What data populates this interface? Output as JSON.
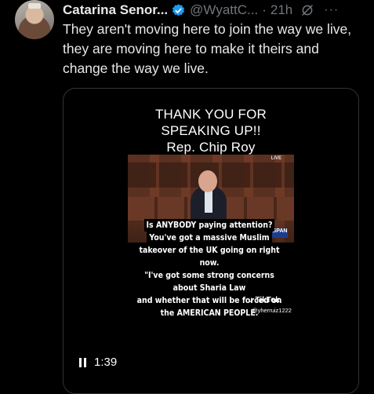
{
  "post": {
    "author_name": "Catarina Senor...",
    "handle": "@WyattC...",
    "separator": "·",
    "time": "21h",
    "more": "···",
    "text": "They aren't moving here to join the way we live, they are moving here to make it theirs and change the way we live."
  },
  "video": {
    "title_lines": [
      "THANK YOU FOR",
      "SPEAKING UP!!",
      "Rep. Chip Roy"
    ],
    "caption_lines": [
      "Is ANYBODY paying attention?",
      "You've got a massive Muslim",
      "takeover of the UK going on right",
      "now.",
      "\"I've got some strong concerns",
      "about Sharia Law",
      "and whether that will be forced on",
      "the AMERICAN PEOPLE."
    ],
    "live_badge": "LIVE",
    "network_logo": "SPAN",
    "watermark_brand": "TikTok",
    "watermark_user": "@yherruiz1222",
    "elapsed": "1:39"
  },
  "colors": {
    "background": "#000000",
    "text": "#e7e9ea",
    "muted": "#71767b",
    "verified": "#1d9bf0",
    "border": "#2f3336"
  },
  "icons": [
    "verified-badge-icon",
    "grok-icon",
    "more-icon",
    "pause-icon"
  ]
}
